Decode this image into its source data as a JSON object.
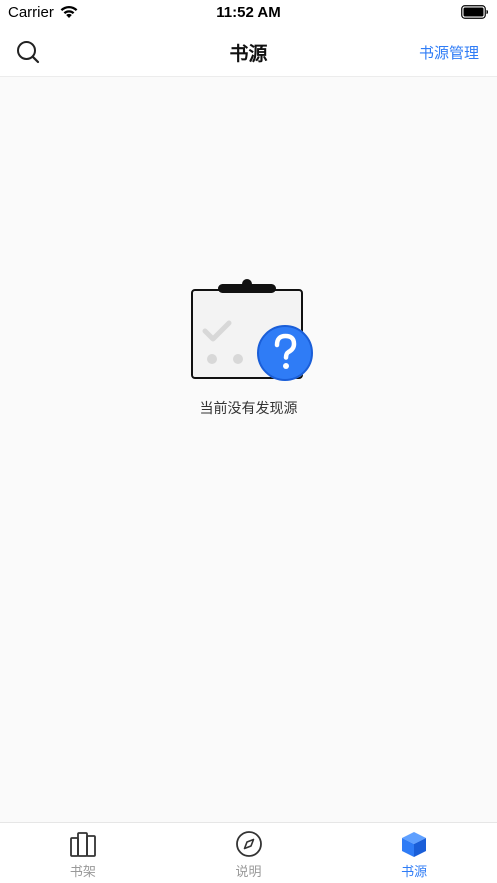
{
  "status_bar": {
    "carrier": "Carrier",
    "time": "11:52 AM",
    "icons": [
      "wifi-icon",
      "battery-icon"
    ]
  },
  "nav": {
    "title": "书源",
    "right_action": "书源管理",
    "left_icon": "search-icon"
  },
  "empty_state": {
    "message": "当前没有发现源",
    "icon": "clipboard-question-icon"
  },
  "tabs": [
    {
      "label": "书架",
      "icon": "bookshelf-icon",
      "active": false
    },
    {
      "label": "说明",
      "icon": "compass-icon",
      "active": false
    },
    {
      "label": "书源",
      "icon": "cube-icon",
      "active": true
    }
  ],
  "colors": {
    "accent": "#2f7cf6",
    "inactive": "#999999",
    "background": "#fafafa"
  }
}
